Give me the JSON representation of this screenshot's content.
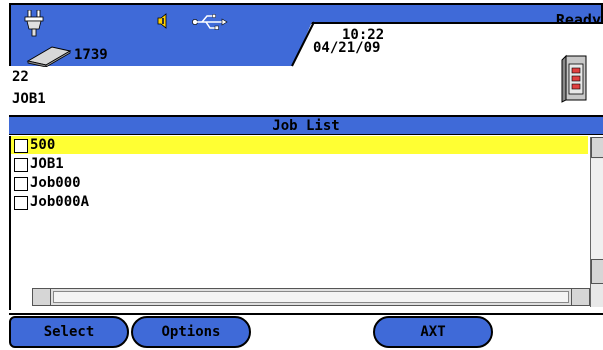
{
  "status_bar": {
    "ready_text": "Ready",
    "counter": "1739",
    "time": "10:22",
    "date": "04/21/09",
    "icons": [
      "plug-icon",
      "speaker-icon",
      "usb-icon",
      "drive-icon",
      "document-icon"
    ]
  },
  "info": {
    "line1": "22",
    "line2": "JOB1"
  },
  "job_list": {
    "title": "Job List",
    "items": [
      {
        "label": "500",
        "checked": false,
        "selected": true
      },
      {
        "label": "JOB1",
        "checked": false,
        "selected": false
      },
      {
        "label": "Job000",
        "checked": false,
        "selected": false
      },
      {
        "label": "Job000A",
        "checked": false,
        "selected": false
      }
    ]
  },
  "softkeys": {
    "select": "Select",
    "options": "Options",
    "axt": "AXT"
  },
  "colors": {
    "accent_blue": "#3f6ad8",
    "selection_yellow": "#ffff33"
  }
}
